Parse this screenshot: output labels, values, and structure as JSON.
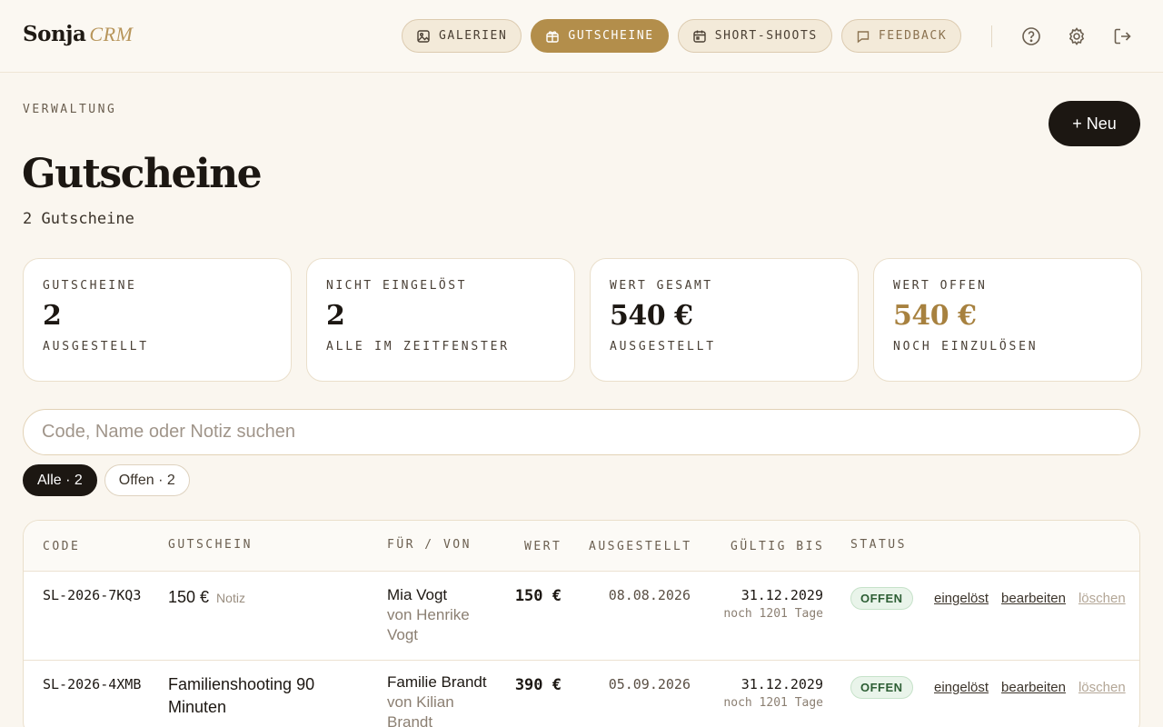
{
  "brand": {
    "name": "Sonja",
    "suffix": "CRM"
  },
  "nav": [
    {
      "label": "GALERIEN",
      "icon": "image-icon"
    },
    {
      "label": "GUTSCHEINE",
      "icon": "gift-icon",
      "active": true
    },
    {
      "label": "SHORT-SHOOTS",
      "icon": "calendar-icon"
    },
    {
      "label": "FEEDBACK",
      "icon": "message-icon"
    }
  ],
  "header_icons": [
    "help-icon",
    "settings-icon",
    "logout-icon"
  ],
  "page": {
    "eyebrow": "VERWALTUNG",
    "title": "Gutscheine",
    "subtitle": "2 Gutscheine",
    "new_button": "+ Neu"
  },
  "stats": [
    {
      "label": "GUTSCHEINE",
      "value": "2",
      "foot": "AUSGESTELLT"
    },
    {
      "label": "NICHT EINGELÖST",
      "value": "2",
      "foot": "ALLE IM ZEITFENSTER"
    },
    {
      "label": "WERT GESAMT",
      "value": "540 €",
      "foot": "AUSGESTELLT"
    },
    {
      "label": "WERT OFFEN",
      "value": "540 €",
      "foot": "NOCH EINZULÖSEN"
    }
  ],
  "search": {
    "placeholder": "Code, Name oder Notiz suchen",
    "value": ""
  },
  "filters": [
    {
      "label": "Alle · 2",
      "active": true
    },
    {
      "label": "Offen · 2",
      "active": false
    }
  ],
  "table": {
    "headers": {
      "code": "CODE",
      "voucher": "GUTSCHEIN",
      "for_from": "FÜR / VON",
      "value": "WERT",
      "issued": "AUSGESTELLT",
      "valid": "GÜLTIG BIS",
      "status": "STATUS"
    },
    "rows": [
      {
        "code": "SL-2026-7KQ3",
        "voucher": "150 €",
        "note": "Notiz",
        "for": "Mia Vogt",
        "from": "von Henrike Vogt",
        "value": "150 €",
        "issued": "08.08.2026",
        "valid_until": "31.12.2029",
        "remaining": "noch 1201 Tage",
        "status": "OFFEN",
        "actions": {
          "redeem": "eingelöst",
          "edit": "bearbeiten",
          "delete": "löschen"
        }
      },
      {
        "code": "SL-2026-4XMB",
        "voucher": "Familienshooting 90 Minuten",
        "note": "",
        "for": "Familie Brandt",
        "from": "von Kilian Brandt",
        "value": "390 €",
        "issued": "05.09.2026",
        "valid_until": "31.12.2029",
        "remaining": "noch 1201 Tage",
        "status": "OFFEN",
        "actions": {
          "redeem": "eingelöst",
          "edit": "bearbeiten",
          "delete": "löschen"
        }
      }
    ]
  },
  "colors": {
    "accent": "#b38e4b",
    "dark": "#1c1712",
    "background": "#faf6ef"
  }
}
